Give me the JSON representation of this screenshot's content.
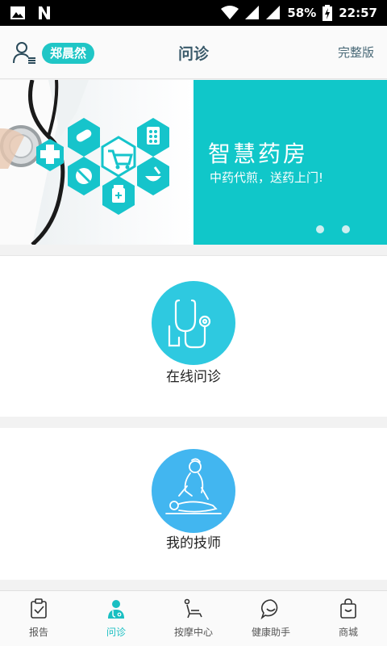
{
  "status_bar": {
    "battery": "58%",
    "time": "22:57",
    "icons": [
      "image-icon",
      "n-icon",
      "wifi-icon",
      "signal-icon",
      "signal-icon",
      "battery-charging-icon"
    ]
  },
  "header": {
    "user_name": "郑晨然",
    "title": "问诊",
    "full_version": "完整版"
  },
  "banner": {
    "title": "智慧药房",
    "subtitle": "中药代煎，送药上门!",
    "slides": 2,
    "active_slide": 2
  },
  "cards": [
    {
      "label": "在线问诊",
      "icon": "stethoscope-icon",
      "color": "#2ec9e0"
    },
    {
      "label": "我的技师",
      "icon": "massage-icon",
      "color": "#42b6f0"
    }
  ],
  "tabs": [
    {
      "label": "报告",
      "icon": "report-icon",
      "active": false
    },
    {
      "label": "问诊",
      "icon": "doctor-icon",
      "active": true
    },
    {
      "label": "按摩中心",
      "icon": "massage-chair-icon",
      "active": false
    },
    {
      "label": "健康助手",
      "icon": "chat-icon",
      "active": false
    },
    {
      "label": "商城",
      "icon": "shopping-bag-icon",
      "active": false
    }
  ],
  "colors": {
    "accent": "#19bfc2",
    "banner_bg": "#10c7c9"
  }
}
